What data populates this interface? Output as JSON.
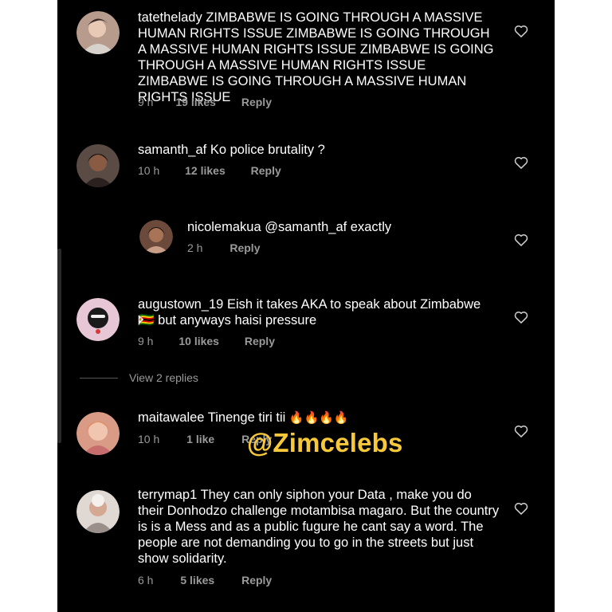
{
  "comments": [
    {
      "username": "tatethelady",
      "text": "ZIMBABWE IS GOING THROUGH A MASSIVE HUMAN RIGHTS ISSUE ZIMBABWE IS GOING THROUGH A MASSIVE HUMAN RIGHTS ISSUE ZIMBABWE IS GOING THROUGH A MASSIVE HUMAN RIGHTS ISSUE ZIMBABWE IS GOING THROUGH A MASSIVE HUMAN RIGHTS ISSUE",
      "time": "9 h",
      "likes": "19 likes",
      "reply": "Reply"
    },
    {
      "username": "samanth_af",
      "text": "Ko police brutality ?",
      "time": "10 h",
      "likes": "12 likes",
      "reply": "Reply"
    },
    {
      "username": "nicolemakua",
      "text": "@samanth_af exactly",
      "time": "2 h",
      "reply": "Reply"
    },
    {
      "username": "augustown_19",
      "text": "Eish it takes AKA to speak about Zimbabwe",
      "flag": "🇿🇼",
      "text2": "but anyways haisi pressure",
      "time": "9 h",
      "likes": "10 likes",
      "reply": "Reply",
      "view_replies": "View 2 replies"
    },
    {
      "username": "maitawalee",
      "text": "Tinenge tiri tii",
      "emoji": "🔥🔥🔥🔥",
      "time": "10 h",
      "likes": "1 like",
      "reply": "Reply"
    },
    {
      "username": "terrymap1",
      "text": "They can only siphon your Data , make you do their Donhodzo challenge motambisa magaro. But the country is is a Mess and as a public fugure he cant say a word. The people are not demanding you to go in the streets but just show solidarity.",
      "time": "6 h",
      "likes": "5 likes",
      "reply": "Reply"
    }
  ],
  "watermark": "@Zimcelebs",
  "icons": {
    "like": "heart-outline-icon"
  },
  "colors": {
    "background": "#000000",
    "meta": "#9a9a9a",
    "watermark": "#f7c93a"
  }
}
